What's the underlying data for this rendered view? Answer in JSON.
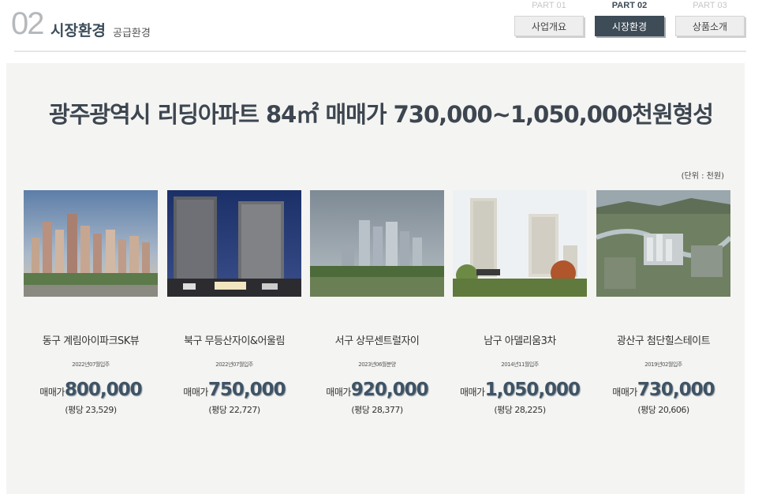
{
  "header": {
    "section_number": "02",
    "section_title": "시장환경",
    "section_subtitle": "공급환경"
  },
  "nav": [
    {
      "part": "PART 01",
      "label": "사업개요",
      "active": false
    },
    {
      "part": "PART 02",
      "label": "시장환경",
      "active": true
    },
    {
      "part": "PART 03",
      "label": "상품소개",
      "active": false
    }
  ],
  "headline": "광주광역시 리딩아파트 84㎡  매매가 730,000~1,050,000천원형성",
  "unit": "(단위 : 천원)",
  "price_label": "매매가",
  "apartments": [
    {
      "name": "동구 계림아이파크SK뷰",
      "date": "2022년07월입주",
      "price": "800,000",
      "per_pyeong": "(평당 23,529)"
    },
    {
      "name": "북구 무등산자이&어울림",
      "date": "2022년07월입주",
      "price": "750,000",
      "per_pyeong": "(평당 22,727)"
    },
    {
      "name": "서구 상무센트럴자이",
      "date": "2023년06월분양",
      "price": "920,000",
      "per_pyeong": "(평당 28,377)"
    },
    {
      "name": "남구 아델리움3차",
      "date": "2014년11월입주",
      "price": "1,050,000",
      "per_pyeong": "(평당 28,225)"
    },
    {
      "name": "광산구 첨단힐스테이트",
      "date": "2019년02월입주",
      "price": "730,000",
      "per_pyeong": "(평당 20,606)"
    }
  ]
}
